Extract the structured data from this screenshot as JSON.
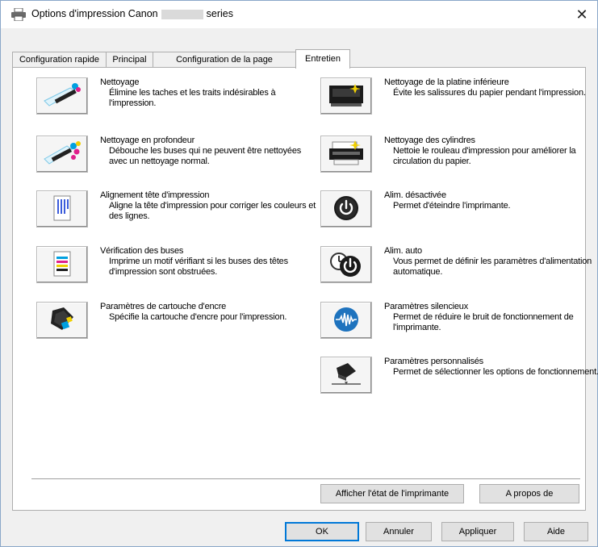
{
  "window": {
    "title_prefix": "Options d'impression Canon",
    "title_suffix": "series",
    "close_glyph": "✕"
  },
  "tabs": [
    {
      "label": "Configuration rapide",
      "active": false
    },
    {
      "label": "Principal",
      "active": false
    },
    {
      "label": "Configuration de la page",
      "active": false
    },
    {
      "label": "Entretien",
      "active": true
    }
  ],
  "left_items": [
    {
      "title": "Nettoyage",
      "desc": "Élimine les taches et les traits indésirables à l'impression.",
      "icon": "cleaning-icon"
    },
    {
      "title": "Nettoyage en profondeur",
      "desc": "Débouche les buses qui ne peuvent être nettoyées avec un nettoyage normal.",
      "icon": "deep-cleaning-icon"
    },
    {
      "title": "Alignement tête d'impression",
      "desc": "Aligne la tête d'impression pour corriger les couleurs et des lignes.",
      "icon": "print-head-alignment-icon"
    },
    {
      "title": "Vérification des buses",
      "desc": "Imprime un motif vérifiant si les buses des têtes d'impression sont obstruées.",
      "icon": "nozzle-check-icon"
    },
    {
      "title": "Paramètres de cartouche d'encre",
      "desc": "Spécifie la cartouche d'encre pour l'impression.",
      "icon": "ink-cartridge-icon"
    }
  ],
  "right_items": [
    {
      "title": "Nettoyage de la platine inférieure",
      "desc": "Évite les salissures du papier pendant l'impression.",
      "icon": "bottom-plate-cleaning-icon"
    },
    {
      "title": "Nettoyage des cylindres",
      "desc": "Nettoie le rouleau d'impression pour améliorer la circulation du papier.",
      "icon": "roller-cleaning-icon"
    },
    {
      "title": "Alim. désactivée",
      "desc": "Permet d'éteindre l'imprimante.",
      "icon": "power-off-icon"
    },
    {
      "title": "Alim. auto",
      "desc": "Vous permet de définir les paramètres d'alimentation automatique.",
      "icon": "auto-power-icon"
    },
    {
      "title": "Paramètres silencieux",
      "desc": "Permet de réduire le bruit de fonctionnement de l'imprimante.",
      "icon": "quiet-settings-icon"
    },
    {
      "title": "Paramètres personnalisés",
      "desc": "Permet de sélectionner les options de fonctionnement.",
      "icon": "custom-settings-icon"
    }
  ],
  "panel_buttons": {
    "printer_status": "Afficher l'état de l'imprimante",
    "about": "A propos de"
  },
  "dialog_buttons": {
    "ok": "OK",
    "cancel": "Annuler",
    "apply": "Appliquer",
    "help": "Aide"
  },
  "colors": {
    "accent": "#0078d7",
    "ink_cyan": "#00a0e0",
    "ink_magenta": "#e0208c",
    "ink_yellow": "#f0d000",
    "power_dark": "#1a1a1a",
    "quiet_blue": "#1e73be"
  }
}
